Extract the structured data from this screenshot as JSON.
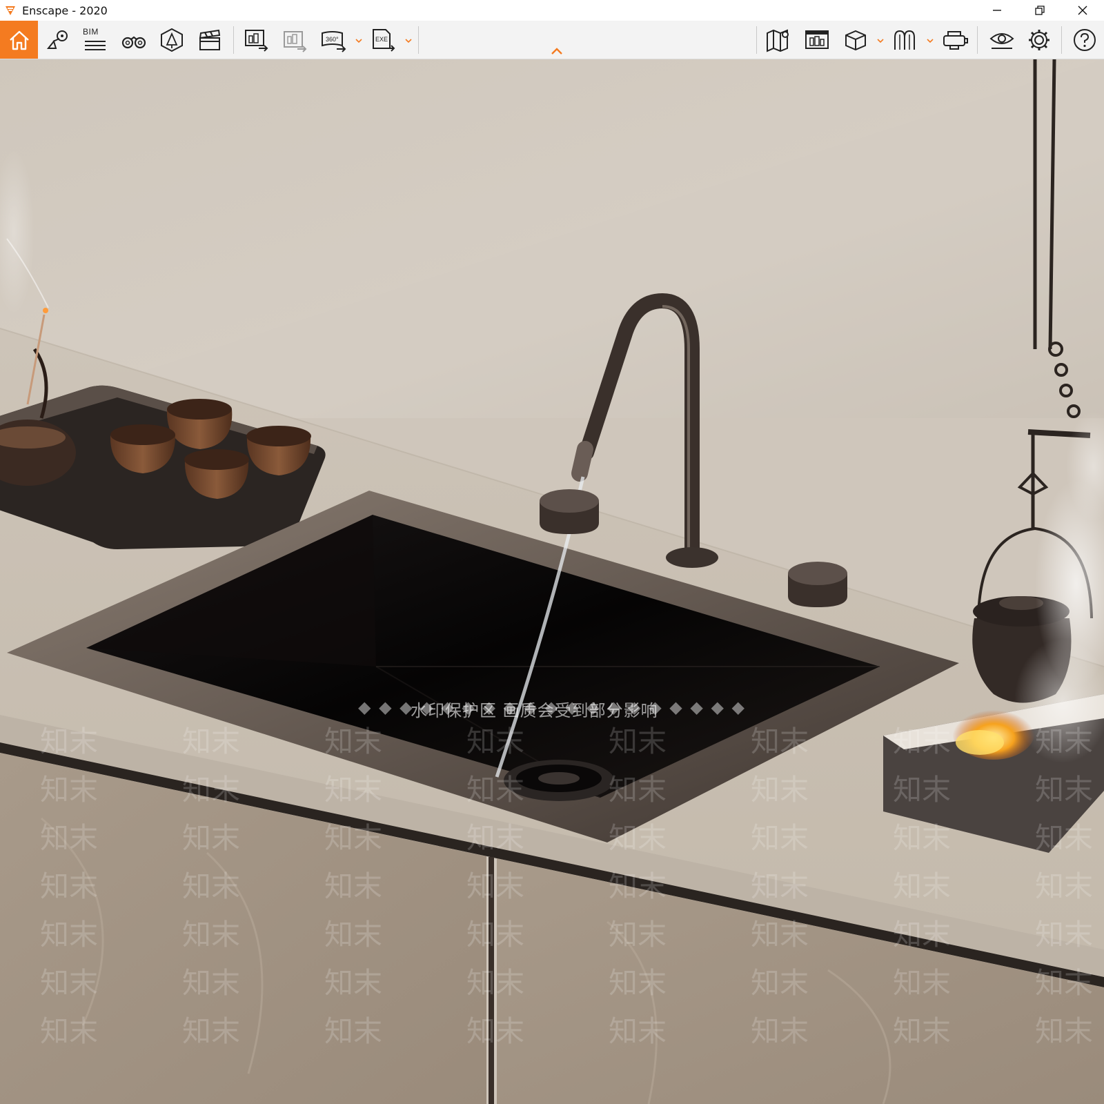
{
  "window": {
    "title": "Enscape - 2020",
    "controls": [
      "minimize-icon",
      "restore-icon",
      "close-icon"
    ]
  },
  "toolbar": {
    "bim_label": "BIM",
    "left_tools": [
      {
        "name": "home-icon",
        "active": true
      },
      {
        "name": "views-icon"
      },
      {
        "name": "bim-icon"
      },
      {
        "name": "binoculars-icon"
      },
      {
        "name": "asset-library-icon"
      },
      {
        "name": "video-editor-icon"
      },
      {
        "name": "batch-render-icon"
      },
      {
        "name": "export-image-icon"
      },
      {
        "name": "panorama-360-icon",
        "text": "360°"
      },
      {
        "name": "export-exe-icon",
        "text": "EXE"
      }
    ],
    "right_tools": [
      {
        "name": "map-icon"
      },
      {
        "name": "render-output-icon"
      },
      {
        "name": "cube-icon"
      },
      {
        "name": "material-editor-icon"
      },
      {
        "name": "vr-headset-icon"
      },
      {
        "name": "visual-settings-icon"
      },
      {
        "name": "settings-gear-icon"
      },
      {
        "name": "help-icon"
      }
    ],
    "accent_color": "#f47b20"
  },
  "viewport": {
    "watermark_notice": "水印保护区 画质会受到部分影响",
    "watermark_tile": "知末",
    "watermark_dots": "◆ ◆ ◆ ◆ ◆ ◆ ◆ ◆ ◆ ◆ ◆ ◆ ◆ ◆ ◆ ◆ ◆ ◆ ◆",
    "scene_description_icons": [
      "sink",
      "faucet",
      "tea-set",
      "kettle",
      "fire-box"
    ]
  }
}
